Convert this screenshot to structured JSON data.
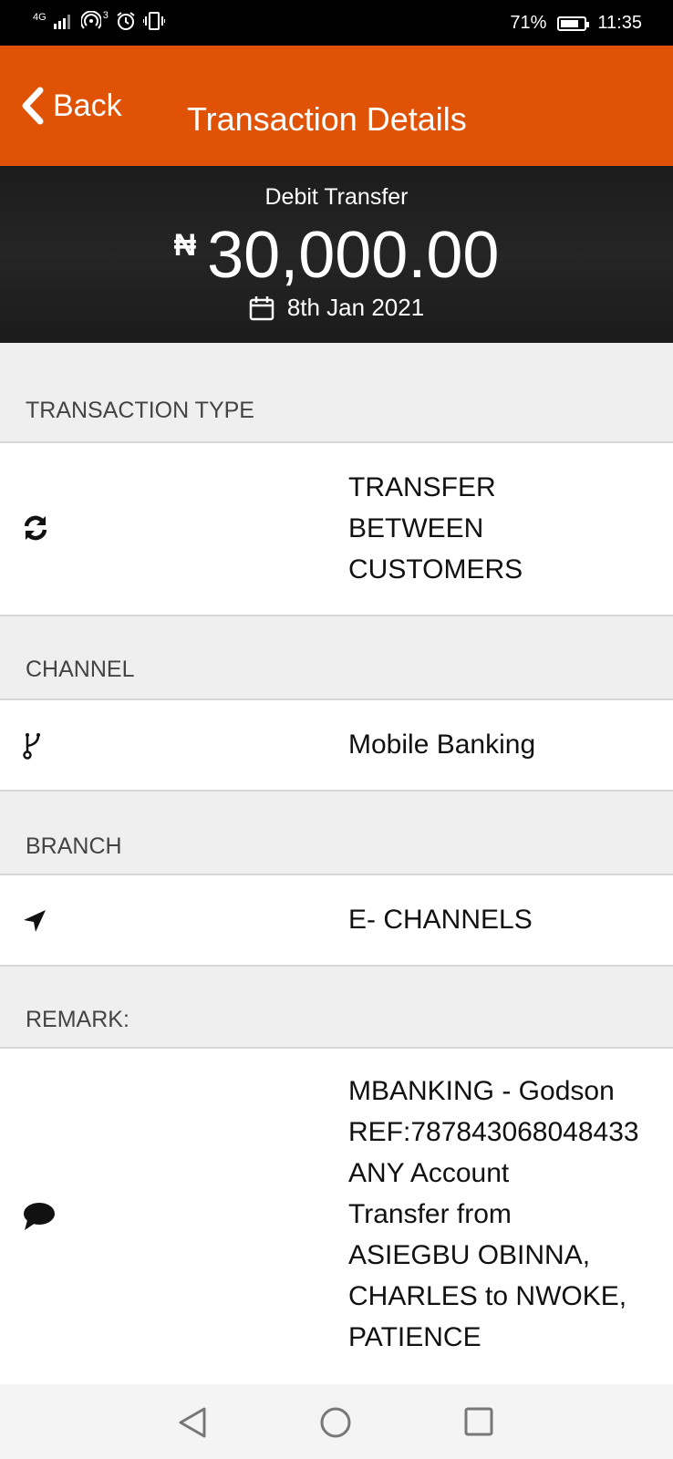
{
  "status_bar": {
    "network": "4G",
    "hotspot_count": "3",
    "battery_percent": "71%",
    "battery_level": 0.71,
    "time": "11:35"
  },
  "header": {
    "back_label": "Back",
    "title": "Transaction Details"
  },
  "summary": {
    "type": "Debit Transfer",
    "currency_symbol": "₦",
    "amount": "30,000.00",
    "date": "8th Jan 2021"
  },
  "sections": {
    "transaction_type": {
      "label": "TRANSACTION TYPE",
      "value": "TRANSFER\nBETWEEN\nCUSTOMERS",
      "icon": "refresh-icon"
    },
    "channel": {
      "label": "CHANNEL",
      "value": "Mobile Banking",
      "icon": "branch-icon"
    },
    "branch": {
      "label": "BRANCH",
      "value": "E- CHANNELS",
      "icon": "location-arrow-icon"
    },
    "remark": {
      "label": "REMARK:",
      "value": "MBANKING - Godson\nREF:787843068048433\nANY Account\nTransfer from\nASIEGBU OBINNA,\nCHARLES to NWOKE,\nPATIENCE",
      "icon": "comment-icon"
    }
  },
  "colors": {
    "accent": "#e05206",
    "summary_bg": "#1f1f1f",
    "section_bg": "#efefef"
  },
  "nav": {
    "back_icon": "triangle-back-icon",
    "home_icon": "circle-home-icon",
    "recents_icon": "square-recents-icon"
  }
}
